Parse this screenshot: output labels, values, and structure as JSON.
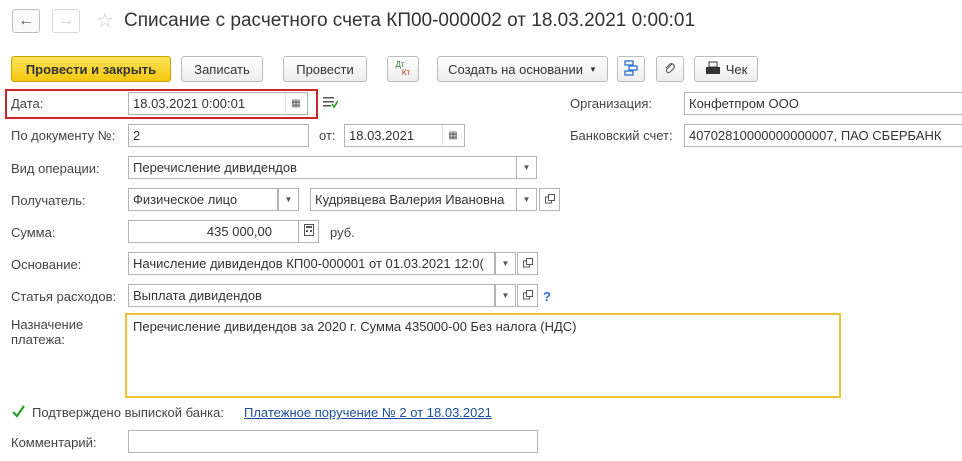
{
  "nav": {
    "back_icon": "arrow-left-icon",
    "forward_icon": "arrow-right-icon",
    "favorite_icon": "star-icon"
  },
  "header": {
    "title": "Списание с расчетного счета КП00-000002 от 18.03.2021 0:00:01"
  },
  "toolbar": {
    "post_close": "Провести и закрыть",
    "save": "Записать",
    "post": "Провести",
    "dtkt_dt": "Дт",
    "dtkt_kt": "Кт",
    "create_based": "Создать на основании",
    "check": "Чек"
  },
  "form": {
    "date_label": "Дата:",
    "date_value": "18.03.2021  0:00:01",
    "doc_no_label": "По документу №:",
    "doc_no_value": "2",
    "from_label": "от:",
    "from_value": "18.03.2021",
    "op_type_label": "Вид операции:",
    "op_type_value": "Перечисление дивидендов",
    "recipient_label": "Получатель:",
    "recipient_type": "Физическое лицо",
    "recipient_name": "Кудрявцева Валерия Ивановна",
    "amount_label": "Сумма:",
    "amount_value": "435 000,00",
    "currency": "руб.",
    "basis_label": "Основание:",
    "basis_value": "Начисление дивидендов КП00-000001 от 01.03.2021 12:0(",
    "expense_label": "Статья расходов:",
    "expense_value": "Выплата дивидендов",
    "help": "?",
    "purpose_label_1": "Назначение",
    "purpose_label_2": "платежа:",
    "purpose_value": "Перечисление дивидендов за 2020 г. Сумма 435000-00 Без налога (НДС)",
    "confirmed_label": "Подтверждено выпиской банка:",
    "payment_link": "Платежное поручение № 2 от 18.03.2021",
    "comment_label": "Комментарий:",
    "comment_value": "",
    "org_label": "Организация:",
    "org_value": "Конфетпром ООО",
    "bank_label": "Банковский счет:",
    "bank_value": "40702810000000000007, ПАО СБЕРБАНК"
  },
  "colors": {
    "primary_button": "#f4c80f",
    "highlight": "#d0262b",
    "focus_border": "#f0c232",
    "link": "#1c4f9e"
  }
}
